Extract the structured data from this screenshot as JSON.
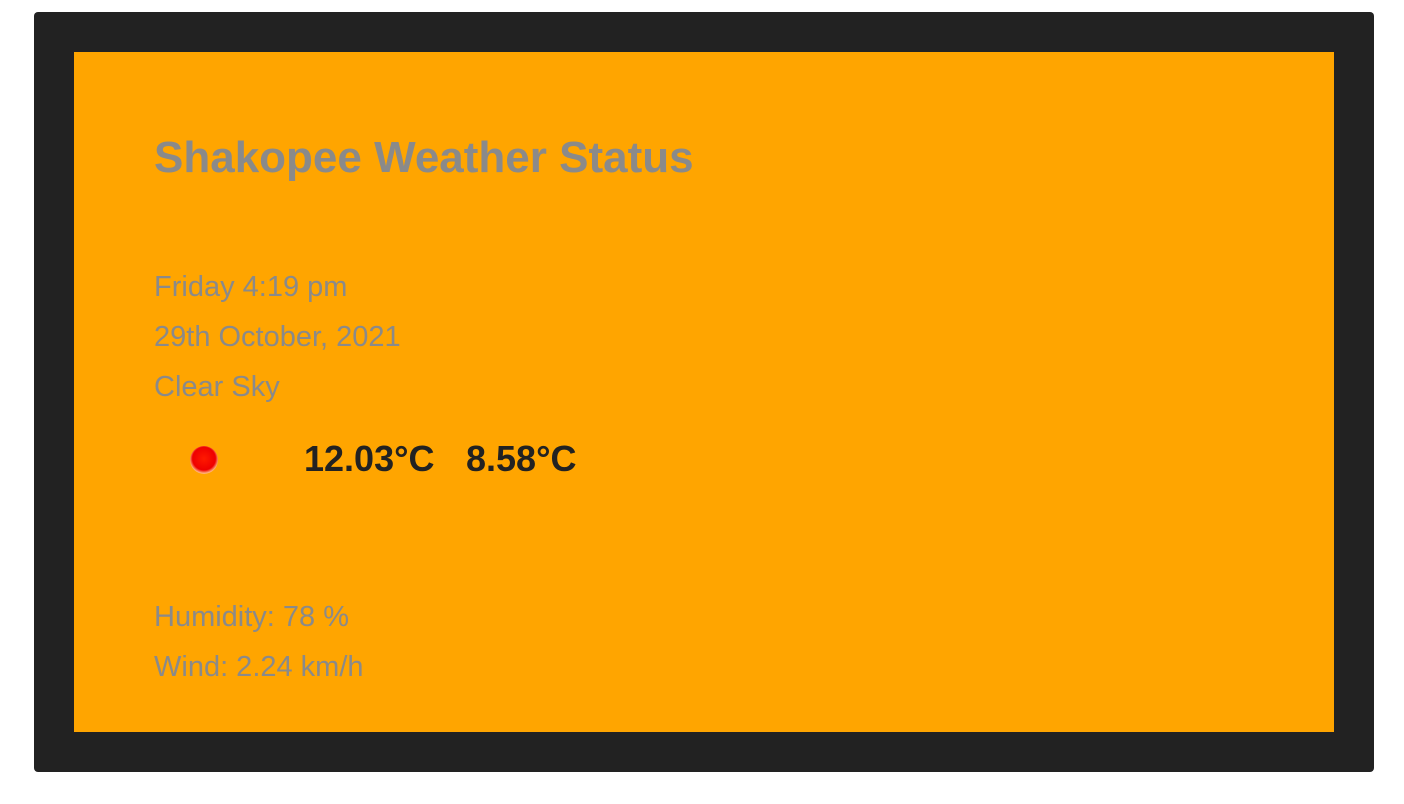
{
  "weather": {
    "title": "Shakopee Weather Status",
    "day_time": "Friday 4:19 pm",
    "date": "29th October, 2021",
    "condition": "Clear Sky",
    "icon": "red-sun-icon",
    "temp_max": "12.03°C",
    "temp_min": "8.58°C",
    "humidity": "Humidity: 78 %",
    "wind": "Wind: 2.24 km/h"
  },
  "colors": {
    "frame": "#222222",
    "card": "#ffa500",
    "muted_text": "#8a8a8a",
    "temp_text": "#222222",
    "icon": "#ee0000"
  }
}
